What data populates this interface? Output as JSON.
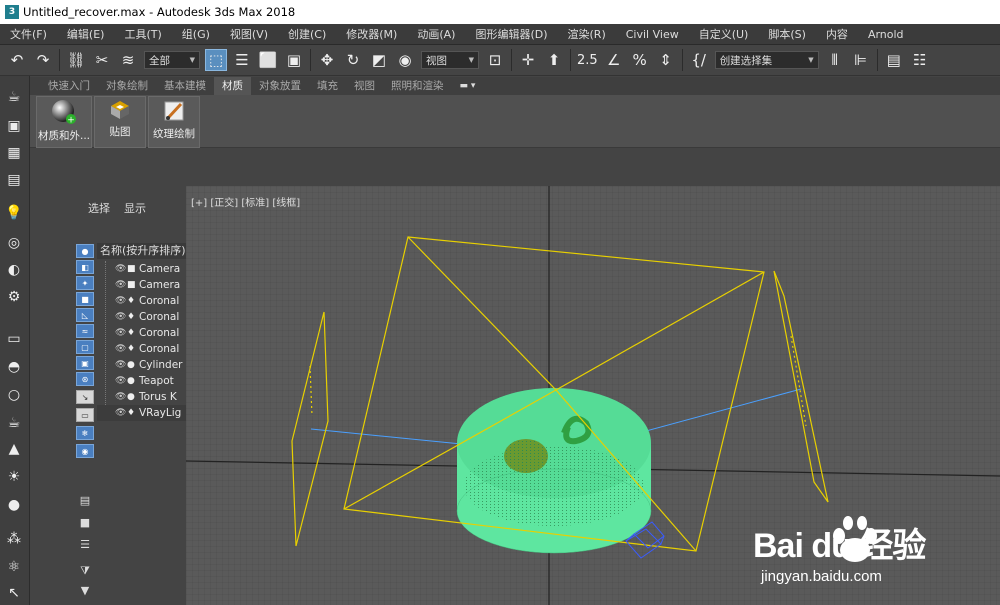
{
  "app": {
    "title": "Untitled_recover.max - Autodesk 3ds Max 2018"
  },
  "menu": {
    "items": [
      "文件(F)",
      "编辑(E)",
      "工具(T)",
      "组(G)",
      "视图(V)",
      "创建(C)",
      "修改器(M)",
      "动画(A)",
      "图形编辑器(D)",
      "渲染(R)",
      "Civil View",
      "自定义(U)",
      "脚本(S)",
      "内容",
      "Arnold"
    ]
  },
  "toolbar": {
    "filter_select": "全部",
    "ref_coord_select": "视图",
    "snap_text": "2.5",
    "named_sel_select": "创建选择集"
  },
  "ribbon": {
    "tabs": [
      "快速入门",
      "对象绘制",
      "基本建模",
      "材质",
      "对象放置",
      "填充",
      "视图",
      "照明和渲染"
    ],
    "active_tab": "材质",
    "buttons": [
      "材质和外...",
      "贴图",
      "纹理绘制"
    ]
  },
  "scene_explorer": {
    "tabs": [
      "选择",
      "显示"
    ],
    "header": "名称(按升序排序)",
    "rows": [
      {
        "name": "Camera",
        "icon": "camera-icon"
      },
      {
        "name": "Camera",
        "icon": "camera-icon"
      },
      {
        "name": "Coronal",
        "icon": "light-icon"
      },
      {
        "name": "Coronal",
        "icon": "light-icon"
      },
      {
        "name": "Coronal",
        "icon": "light-icon"
      },
      {
        "name": "Coronal",
        "icon": "light-icon"
      },
      {
        "name": "Cylinder",
        "icon": "geometry-icon"
      },
      {
        "name": "Teapot",
        "icon": "geometry-icon"
      },
      {
        "name": "Torus K",
        "icon": "geometry-icon"
      },
      {
        "name": "VRayLig",
        "icon": "light-icon"
      }
    ]
  },
  "viewport": {
    "label": "[+] [正交] [标准] [线框]"
  },
  "watermark": {
    "brand": "Bai du 经验",
    "url": "jingyan.baidu.com"
  },
  "colors": {
    "accent": "#5a8fbf",
    "viewport_bg": "#575757",
    "wire_yellow": "#e8d000",
    "cylinder_green": "#5ee6a0"
  }
}
